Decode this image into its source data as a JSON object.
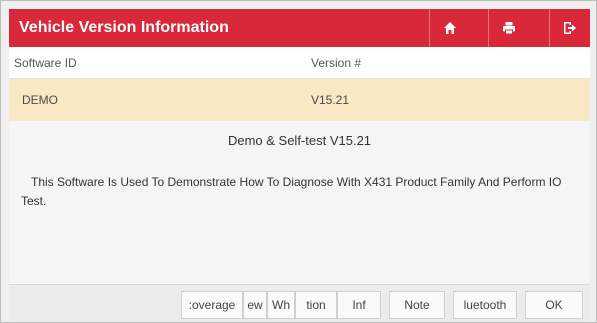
{
  "header": {
    "title": "Vehicle Version Information",
    "icons": [
      "home-icon",
      "print-icon",
      "exit-icon"
    ],
    "background_color": "#d8283a"
  },
  "table": {
    "headers": [
      "Software ID",
      "Version #"
    ],
    "rows": [
      {
        "software_id": "DEMO",
        "version": "V15.21"
      }
    ],
    "selected_row_color": "#f8e8c4"
  },
  "detail": {
    "title": "Demo & Self-test V15.21",
    "description": "This Software Is Used To Demonstrate How To Diagnose With X431 Product Family And Perform IO Test."
  },
  "bottom_bar": {
    "tabs": [
      {
        "label": ":overage"
      },
      {
        "label": "ew"
      },
      {
        "label": "Wh"
      },
      {
        "label": "tion"
      },
      {
        "label": "Inf"
      },
      {
        "label": "Note"
      },
      {
        "label": "luetooth"
      },
      {
        "label": "OK"
      }
    ]
  }
}
